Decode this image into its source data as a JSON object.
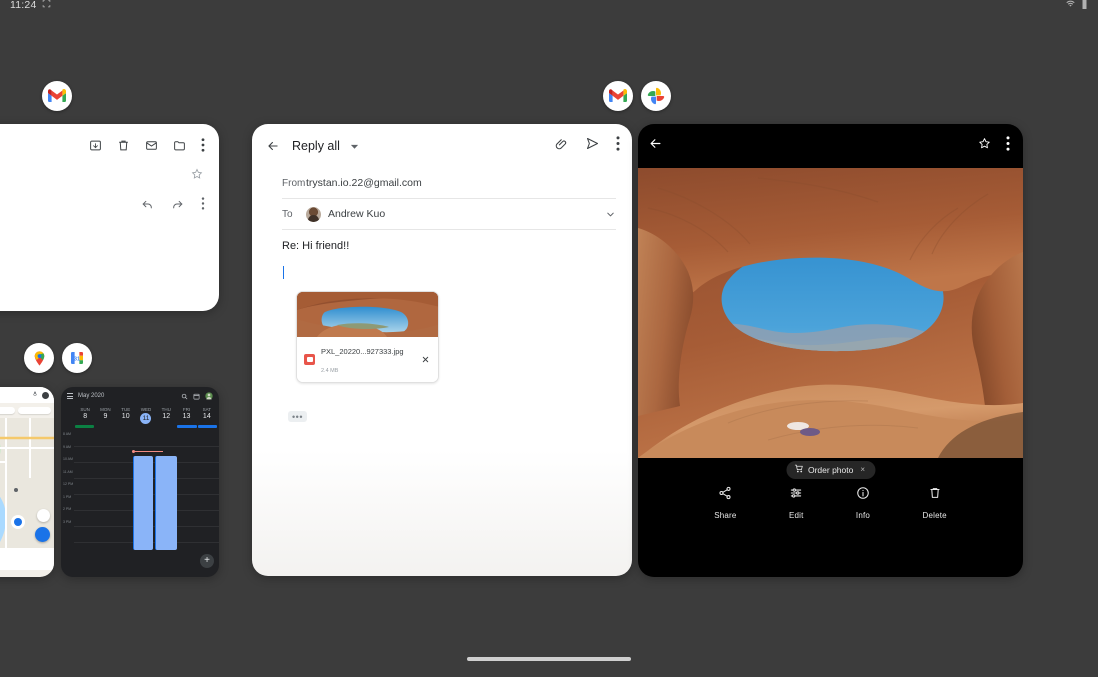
{
  "statusbar": {
    "time": "11:24",
    "icons": [
      "screenshot-icon",
      "wifi-icon",
      "battery-icon"
    ]
  },
  "app_icon_rows": {
    "left": [
      {
        "name": "gmail",
        "label": "Gmail"
      }
    ],
    "center": [
      {
        "name": "gmail",
        "label": "Gmail"
      },
      {
        "name": "photos",
        "label": "Google Photos"
      }
    ],
    "bottom_left": [
      {
        "name": "maps",
        "label": "Maps"
      },
      {
        "name": "calendar",
        "label": "Calendar"
      }
    ]
  },
  "gmail_left_card": {
    "toolbar_icons": [
      "archive-icon",
      "delete-icon",
      "mark-unread-icon",
      "move-to-icon",
      "overflow-menu-icon"
    ],
    "star_icon": "star-outline-icon",
    "action_icons": [
      "reply-icon",
      "forward-icon",
      "overflow-menu-icon"
    ]
  },
  "compose": {
    "back_label": "back",
    "title": "Reply all",
    "dropdown_caret": "▾",
    "top_actions": [
      "attach-icon",
      "send-icon",
      "overflow-menu-icon"
    ],
    "from_label": "From",
    "from_value": "trystan.io.22@gmail.com",
    "to_label": "To",
    "to_recipient": "Andrew Kuo",
    "expand_caret": "chevron-down-icon",
    "subject": "Re: Hi friend!!",
    "body": "",
    "attachment": {
      "filename": "PXL_20220...927333.jpg",
      "size": "2.4 MB",
      "type_icon": "image-file-icon",
      "remove_label": "×"
    },
    "quoted_toggle": "•••"
  },
  "photos": {
    "back_label": "back",
    "star_icon": "star-outline-icon",
    "overflow_icon": "overflow-menu-icon",
    "chip": {
      "icon": "shopping-cart-icon",
      "label": "Order photo",
      "dismiss": "×"
    },
    "actions": [
      {
        "name": "share",
        "label": "Share",
        "icon": "share-icon"
      },
      {
        "name": "edit",
        "label": "Edit",
        "icon": "tune-icon"
      },
      {
        "name": "info",
        "label": "Info",
        "icon": "info-icon"
      },
      {
        "name": "delete",
        "label": "Delete",
        "icon": "trash-icon"
      }
    ]
  },
  "maps_card": {
    "title": ""
  },
  "calendar_card": {
    "month": "May 2020",
    "days": [
      {
        "dow": "SUN",
        "num": "8",
        "today": false
      },
      {
        "dow": "MON",
        "num": "9",
        "today": false
      },
      {
        "dow": "TUE",
        "num": "10",
        "today": false
      },
      {
        "dow": "WED",
        "num": "11",
        "today": true
      },
      {
        "dow": "THU",
        "num": "12",
        "today": false
      },
      {
        "dow": "FRI",
        "num": "13",
        "today": false
      },
      {
        "dow": "SAT",
        "num": "14",
        "today": false
      }
    ],
    "hours": [
      "8 AM",
      "9 AM",
      "10 AM",
      "11 AM",
      "12 PM",
      "1 PM",
      "2 PM",
      "3 PM"
    ],
    "events": [
      {
        "label": "",
        "col": 3
      },
      {
        "label": "",
        "col": 4
      }
    ],
    "fab_label": "+"
  },
  "colors": {
    "background": "#3c3c3c",
    "card_white": "#ffffff",
    "card_black": "#000000",
    "accent_blue": "#1a73e8",
    "calendar_event": "#8ab4f8",
    "gmail_red": "#e8554a"
  }
}
